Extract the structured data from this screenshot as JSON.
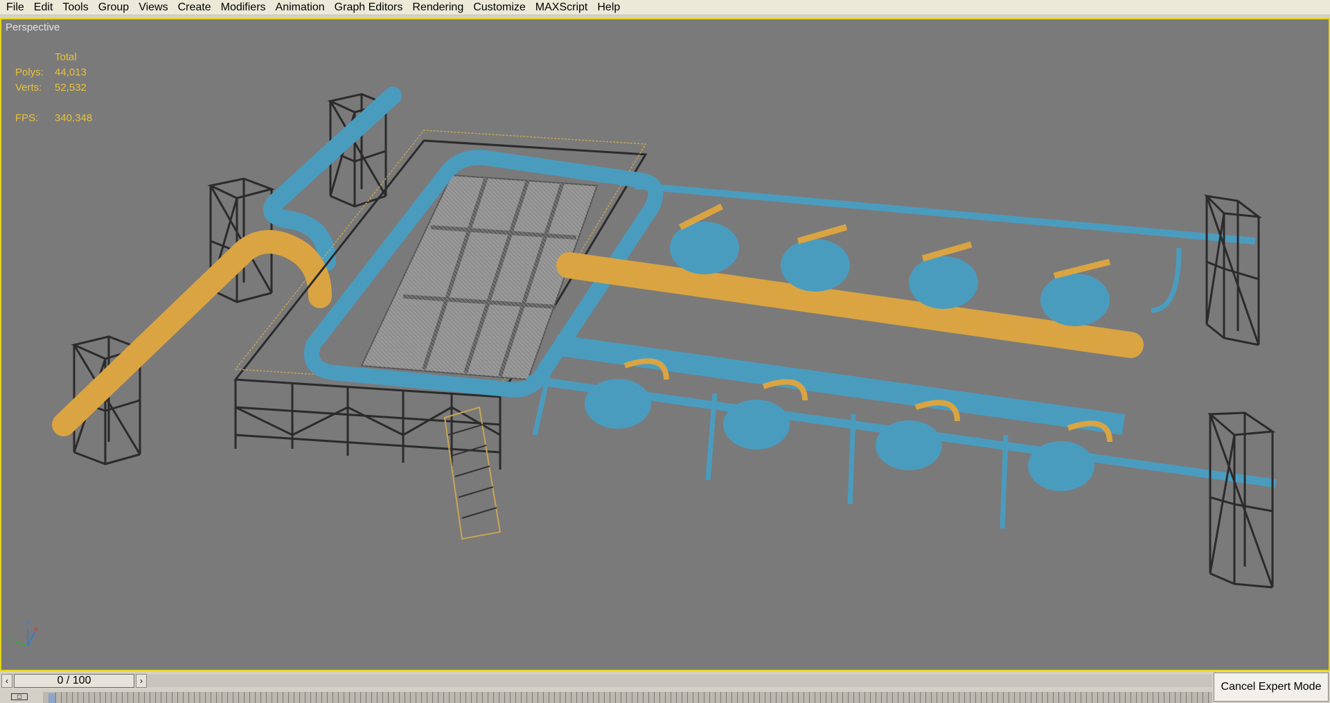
{
  "menubar": {
    "items": [
      "File",
      "Edit",
      "Tools",
      "Group",
      "Views",
      "Create",
      "Modifiers",
      "Animation",
      "Graph Editors",
      "Rendering",
      "Customize",
      "MAXScript",
      "Help"
    ]
  },
  "viewport": {
    "label": "Perspective",
    "stats": {
      "header": "Total",
      "polys_label": "Polys:",
      "polys_value": "44,013",
      "verts_label": "Verts:",
      "verts_value": "52,532",
      "fps_label": "FPS:",
      "fps_value": "340.348"
    },
    "gizmo": {
      "z": "z",
      "x": "x",
      "y": "y"
    },
    "colors": {
      "background": "#7a7a7a",
      "active_border": "#e3d51c",
      "stats_text": "#e8c23a",
      "pipe_blue": "#4a9cbf",
      "pipe_orange": "#d9a441",
      "steel": "#2b2b2b"
    }
  },
  "timeline": {
    "prev_icon": "chevron-left-icon",
    "next_icon": "chevron-right-icon",
    "frame_display": "0 / 100",
    "current_frame": 0,
    "total_frames": 100
  },
  "status": {
    "cancel_expert_label": "Cancel Expert Mode",
    "key_icon": "key-icon"
  }
}
